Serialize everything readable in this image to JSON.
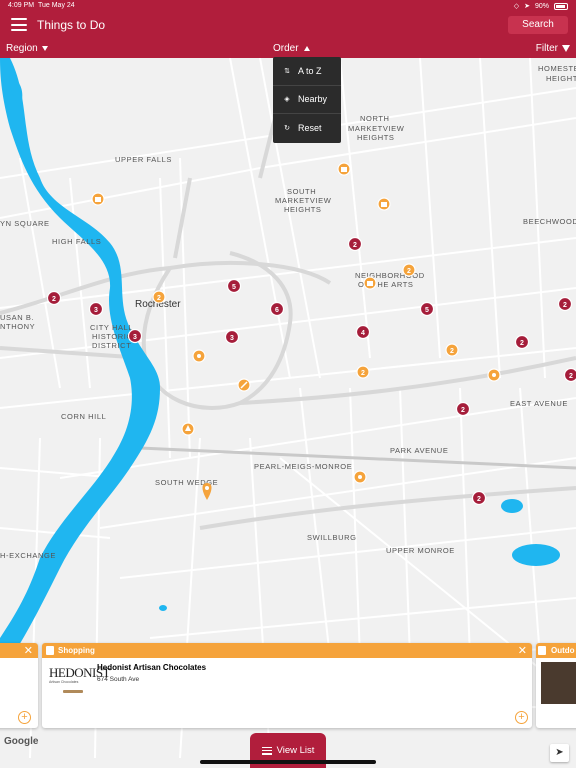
{
  "status_bar": {
    "time": "4:09 PM",
    "date": "Tue May 24",
    "battery": "90%"
  },
  "header": {
    "title": "Things to Do",
    "search_label": "Search"
  },
  "subbar": {
    "region_label": "Region",
    "order_label": "Order",
    "filter_label": "Filter"
  },
  "order_menu": [
    {
      "label": "A to Z",
      "icon": "sort-icon"
    },
    {
      "label": "Nearby",
      "icon": "nearby-icon"
    },
    {
      "label": "Reset",
      "icon": "reset-icon"
    }
  ],
  "map": {
    "city_label": "Rochester",
    "areas": [
      "HOMESTEAD",
      "HEIGHTS",
      "NORTH",
      "MARKETVIEW",
      "HEIGHTS",
      "UPPER FALLS",
      "SOUTH",
      "MARKETVIEW",
      "HEIGHTS",
      "BEECHWOOD",
      "YN SQUARE",
      "HIGH FALLS",
      "NEIGHBORHOOD",
      "OF THE ARTS",
      "USAN B.",
      "NTHONY",
      "CITY HALL",
      "HISTORIC",
      "DISTRICT",
      "EAST AVENUE",
      "CORN HILL",
      "PARK AVENUE",
      "PEARL-MEIGS-MONROE",
      "SOUTH WEDGE",
      "SWILLBURG",
      "UPPER MONROE",
      "H-EXCHANGE"
    ],
    "markers": {
      "red_counts": [
        "2",
        "3",
        "5",
        "6",
        "3",
        "3",
        "2",
        "4",
        "5",
        "2",
        "2",
        "2",
        "2",
        "2"
      ],
      "orange_counts": [
        "2",
        "2",
        "2",
        "2"
      ]
    },
    "attribution": "Google"
  },
  "cards": [
    {
      "category": "Shopping",
      "name": "Hedonist Artisan Chocolates",
      "address": "674 South Ave",
      "logo_text": "HEDONIST",
      "logo_subtext": "Artisan Chocolates"
    },
    {
      "category": "Outdo"
    }
  ],
  "view_list_label": "View List",
  "colors": {
    "brand": "#b11e3c",
    "accent": "#f5a33b",
    "water": "#1fb6f0"
  }
}
